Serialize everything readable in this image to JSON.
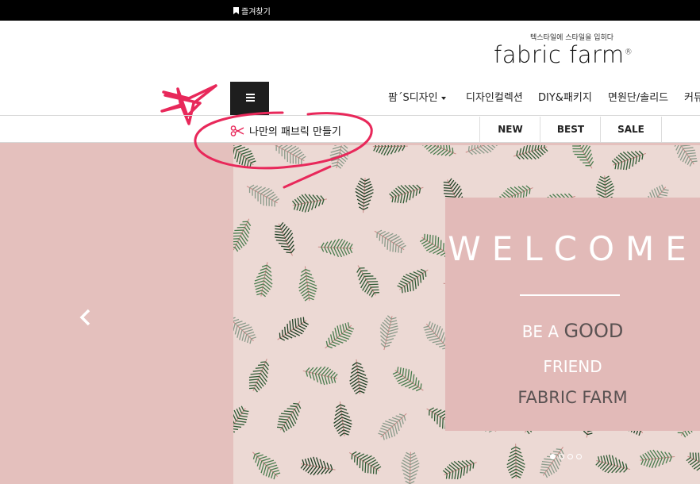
{
  "topbar": {
    "bookmark_label": "즐겨찾기",
    "bookmark_icon": "bookmark-icon"
  },
  "brand": {
    "tagline": "텍스타일에 스타일을 입히다",
    "logo": "fabric farm",
    "logo_mark": "®"
  },
  "nav": {
    "menu_icon": "hamburger-menu-icon",
    "items": [
      {
        "label": "팜´S디자인",
        "has_dropdown": true
      },
      {
        "label": "디자인컬렉션"
      },
      {
        "label": "DIY&패키지"
      },
      {
        "label": "면원단/솔리드"
      },
      {
        "label": "커뮤"
      }
    ]
  },
  "subnav": {
    "make_fabric_label": "나만의 패브릭 만들기",
    "make_fabric_icon": "scissors-icon",
    "categories": [
      "NEW",
      "BEST",
      "SALE"
    ]
  },
  "hero": {
    "welcome": "WELCOME",
    "line1_prefix": "BE A",
    "line1_emph": "GOOD",
    "line2": "FRIEND",
    "line3": "FABRIC FARM",
    "prev_icon": "chevron-left-icon",
    "slides_total": 4,
    "active_slide": 1
  },
  "annotations": {
    "color": "#e8285a",
    "shapes": [
      "star",
      "ellipse"
    ]
  },
  "colors": {
    "hero_bg": "#e4c0bd",
    "pattern_bg": "#ecd9d4",
    "card_bg": "#e2bab8",
    "accent": "#e8285a",
    "text_dark": "#5a5252"
  }
}
